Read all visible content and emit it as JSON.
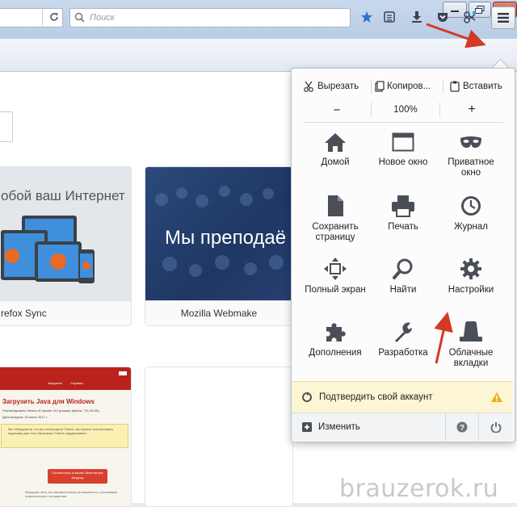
{
  "window": {
    "min_icon": "minimize-icon",
    "max_icon": "maximize-icon",
    "close_icon": "close-icon"
  },
  "search": {
    "placeholder": "Поиск"
  },
  "toolbar": {
    "icons": [
      "bookmark-star-icon",
      "bookmarks-list-icon",
      "download-icon",
      "pocket-icon",
      "extension-icon",
      "hamburger-menu-icon"
    ]
  },
  "tiles": [
    {
      "banner": "обой ваш Интернет",
      "caption": "refox Sync"
    },
    {
      "banner": "Мы преподаё",
      "caption": "Mozilla Webmake"
    }
  ],
  "java_page": {
    "tabs": [
      "Загрузить",
      "Справка"
    ],
    "title": "Загрузить Java для Windows",
    "line": "Рекомендовано Version 8 Update 144 (размер файла: 731.06 КБ)",
    "date": "Дата выпуска: 26 июля 2017 г.",
    "warning": "Мы обнаружили, что вы используете Firefox, вы можете использовать подсказку для этого браузера. Firefox поддерживает...",
    "button": "Согласиться и начать бесплатную загрузку",
    "footer": "Загружая Java, вы автоматически соглашаетесь с условиями лицензионного соглашения"
  },
  "menu": {
    "edit": {
      "cut": "Вырезать",
      "copy": "Копиров...",
      "paste": "Вставить"
    },
    "zoom": {
      "minus": "−",
      "value": "100%",
      "plus": "+"
    },
    "items": [
      {
        "label": "Домой",
        "icon": "home-icon"
      },
      {
        "label": "Новое окно",
        "icon": "new-window-icon"
      },
      {
        "label": "Приватное окно",
        "icon": "private-mask-icon"
      },
      {
        "label": "Сохранить страницу",
        "icon": "save-page-icon"
      },
      {
        "label": "Печать",
        "icon": "print-icon"
      },
      {
        "label": "Журнал",
        "icon": "history-clock-icon"
      },
      {
        "label": "Полный экран",
        "icon": "fullscreen-icon"
      },
      {
        "label": "Найти",
        "icon": "find-icon"
      },
      {
        "label": "Настройки",
        "icon": "settings-gear-icon"
      },
      {
        "label": "Дополнения",
        "icon": "addons-puzzle-icon"
      },
      {
        "label": "Разработка",
        "icon": "developer-wrench-icon"
      },
      {
        "label": "Облачные вкладки",
        "icon": "synced-tabs-icon"
      }
    ],
    "verify": "Подтвердить свой аккаунт",
    "customize": "Изменить"
  },
  "watermark": "brauzerok.ru",
  "colors": {
    "accent_blue": "#2e73d0",
    "arrow_red": "#d23a26",
    "verify_bg": "#fdf6d4",
    "warning_yellow": "#e8b311"
  }
}
